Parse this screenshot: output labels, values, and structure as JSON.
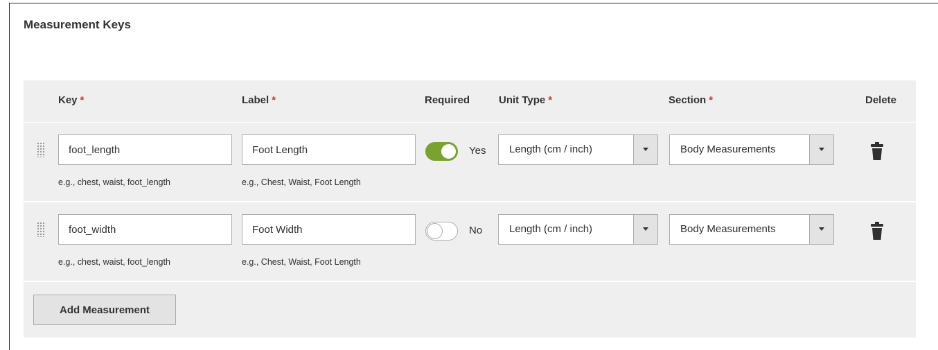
{
  "section": {
    "title": "Measurement Keys"
  },
  "headers": {
    "key": "Key",
    "label": "Label",
    "required": "Required",
    "unit_type": "Unit Type",
    "section": "Section",
    "delete": "Delete",
    "required_marker": "*"
  },
  "rows": [
    {
      "key": "foot_length",
      "key_note": "e.g., chest, waist, foot_length",
      "label": "Foot Length",
      "label_note": "e.g., Chest, Waist, Foot Length",
      "required": true,
      "required_text": "Yes",
      "unit_type": "Length (cm / inch)",
      "section": "Body Measurements"
    },
    {
      "key": "foot_width",
      "key_note": "e.g., chest, waist, foot_length",
      "label": "Foot Width",
      "label_note": "e.g., Chest, Waist, Foot Length",
      "required": false,
      "required_text": "No",
      "unit_type": "Length (cm / inch)",
      "section": "Body Measurements"
    }
  ],
  "actions": {
    "add_label": "Add Measurement"
  },
  "colors": {
    "required_marker": "#e02b27",
    "toggle_on": "#79a22e",
    "table_bg": "#efefef",
    "border": "#adadad"
  },
  "icons": {
    "drag": "drag-handle-icon",
    "delete": "trash-icon",
    "dropdown": "chevron-down-icon"
  }
}
